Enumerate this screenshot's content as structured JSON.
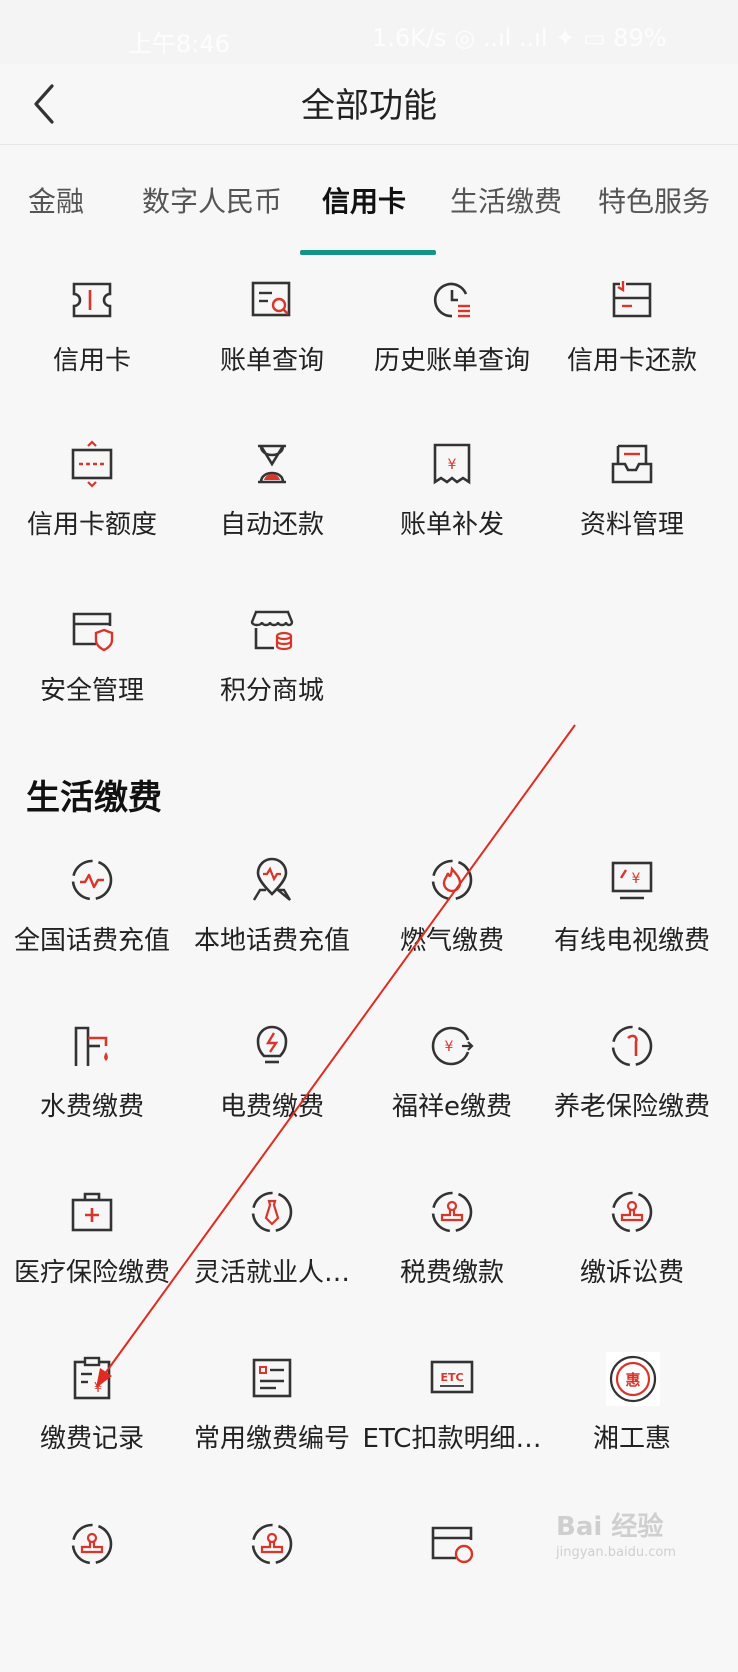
{
  "status": {
    "time": "上午8:46",
    "right": "1.6K/s ◎ ..ıl ..ıl ✦ ▭ 89%"
  },
  "header": {
    "title": "全部功能"
  },
  "tabs": [
    {
      "label": "金融"
    },
    {
      "label": "数字人民币"
    },
    {
      "label": "信用卡"
    },
    {
      "label": "生活缴费"
    },
    {
      "label": "特色服务"
    }
  ],
  "credit_items": [
    {
      "label": "信用卡",
      "icon": "card-icon"
    },
    {
      "label": "账单查询",
      "icon": "bill-search-icon"
    },
    {
      "label": "历史账单查询",
      "icon": "history-bill-icon"
    },
    {
      "label": "信用卡还款",
      "icon": "repay-icon"
    },
    {
      "label": "信用卡额度",
      "icon": "limit-icon"
    },
    {
      "label": "自动还款",
      "icon": "hourglass-icon"
    },
    {
      "label": "账单补发",
      "icon": "receipt-icon"
    },
    {
      "label": "资料管理",
      "icon": "inbox-icon"
    },
    {
      "label": "安全管理",
      "icon": "card-shield-icon"
    },
    {
      "label": "积分商城",
      "icon": "store-icon"
    }
  ],
  "section": {
    "title": "生活缴费"
  },
  "life_items": [
    {
      "label": "全国话费充值",
      "icon": "pulse-circle-icon"
    },
    {
      "label": "本地话费充值",
      "icon": "location-icon"
    },
    {
      "label": "燃气缴费",
      "icon": "flame-icon"
    },
    {
      "label": "有线电视缴费",
      "icon": "tv-icon"
    },
    {
      "label": "水费缴费",
      "icon": "faucet-icon"
    },
    {
      "label": "电费缴费",
      "icon": "bulb-icon"
    },
    {
      "label": "福祥e缴费",
      "icon": "yuan-circle-icon"
    },
    {
      "label": "养老保险缴费",
      "icon": "cane-icon"
    },
    {
      "label": "医疗保险缴费",
      "icon": "medical-kit-icon"
    },
    {
      "label": "灵活就业人…",
      "icon": "tie-icon"
    },
    {
      "label": "税费缴款",
      "icon": "stamp-icon"
    },
    {
      "label": "缴诉讼费",
      "icon": "stamp-circle-icon"
    },
    {
      "label": "缴费记录",
      "icon": "clipboard-yuan-icon"
    },
    {
      "label": "常用缴费编号",
      "icon": "list-doc-icon"
    },
    {
      "label": "ETC扣款明细…",
      "icon": "etc-icon",
      "etc_text": "ETC"
    },
    {
      "label": "湘工惠",
      "icon": "hui-logo-icon",
      "badge": "惠"
    },
    {
      "label": "",
      "icon": "stamp-circle-icon"
    },
    {
      "label": "",
      "icon": "stamp-circle-icon"
    },
    {
      "label": "",
      "icon": "card-logo-icon"
    }
  ],
  "watermark": {
    "main": "Bai 经验",
    "sub": "jingyan.baidu.com"
  },
  "colors": {
    "accent": "#139489",
    "icon_dark": "#333333",
    "icon_red": "#d9362b",
    "annotation": "#e02b20"
  }
}
